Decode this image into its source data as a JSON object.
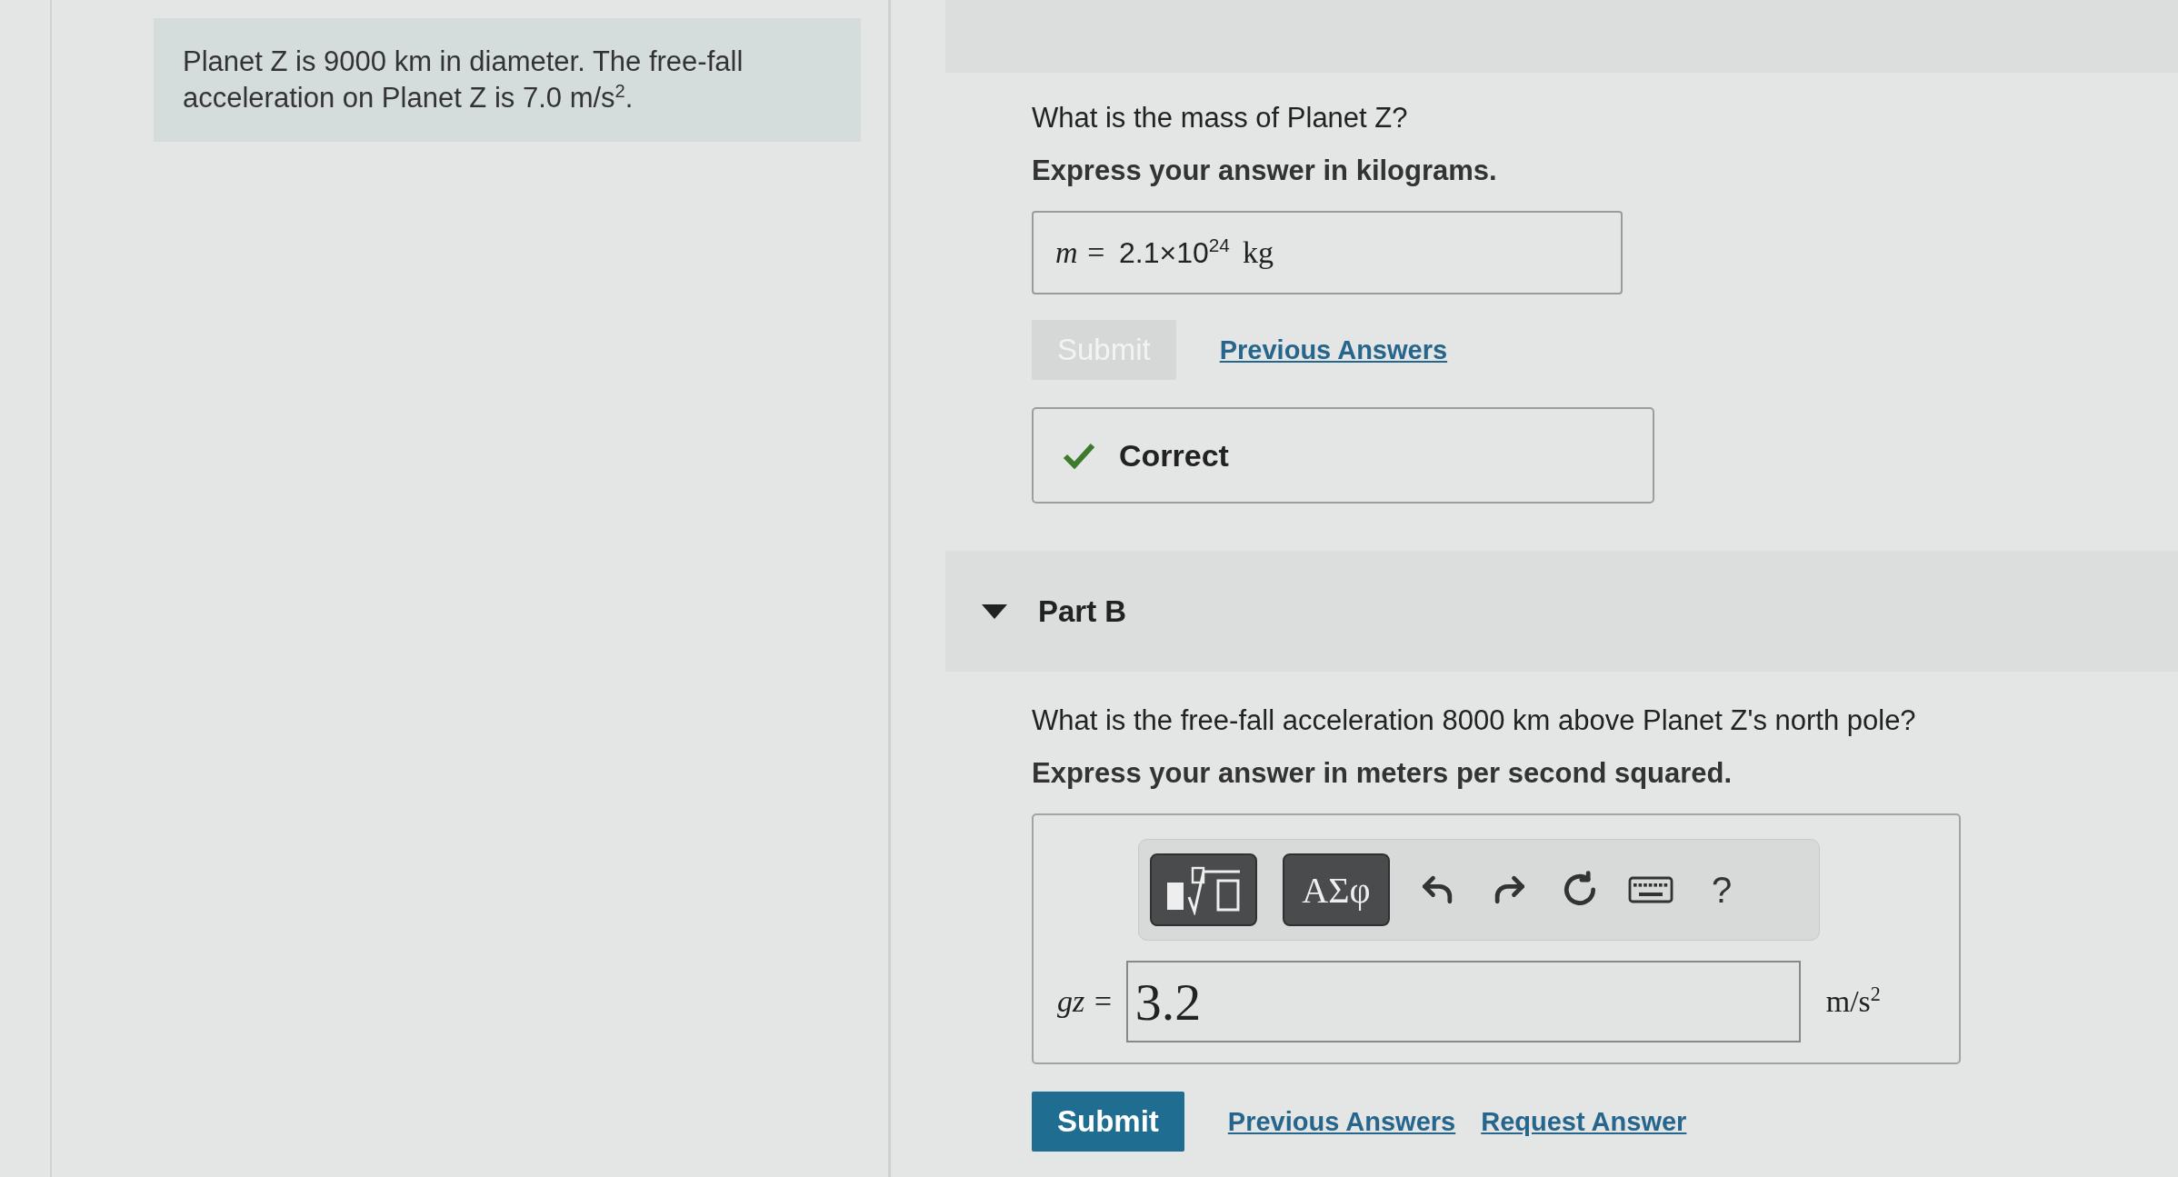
{
  "problem": {
    "text": "Planet Z is 9000 km in diameter. The free-fall acceleration on Planet Z is 7.0 m/s$^{2}$."
  },
  "part_a": {
    "question": "What is the mass of Planet Z?",
    "instruction": "Express your answer in kilograms.",
    "answer": {
      "variable": "m =",
      "value": "2.1×10$^{24}$",
      "unit": "kg"
    },
    "submit": {
      "label": "Submit",
      "disabled": true
    },
    "links": [
      "Previous Answers"
    ],
    "feedback": {
      "kind": "correct",
      "text": "Correct"
    }
  },
  "part_b": {
    "header": {
      "label": "Part B",
      "expanded": true
    },
    "question": "What is the free-fall acceleration 8000 km above Planet Z's north pole?",
    "instruction": "Express your answer in meters per second squared.",
    "toolbar": [
      {
        "kind": "template"
      },
      {
        "kind": "greek",
        "label": "ΑΣφ"
      },
      {
        "kind": "undo"
      },
      {
        "kind": "redo"
      },
      {
        "kind": "reset"
      },
      {
        "kind": "keyboard"
      },
      {
        "kind": "help",
        "label": "?"
      }
    ],
    "answer": {
      "variable": "gz =",
      "value": "3.2",
      "unit": "m/s$^{2}$"
    },
    "submit": {
      "label": "Submit",
      "disabled": false
    },
    "links": [
      "Previous Answers",
      "Request Answer"
    ]
  }
}
